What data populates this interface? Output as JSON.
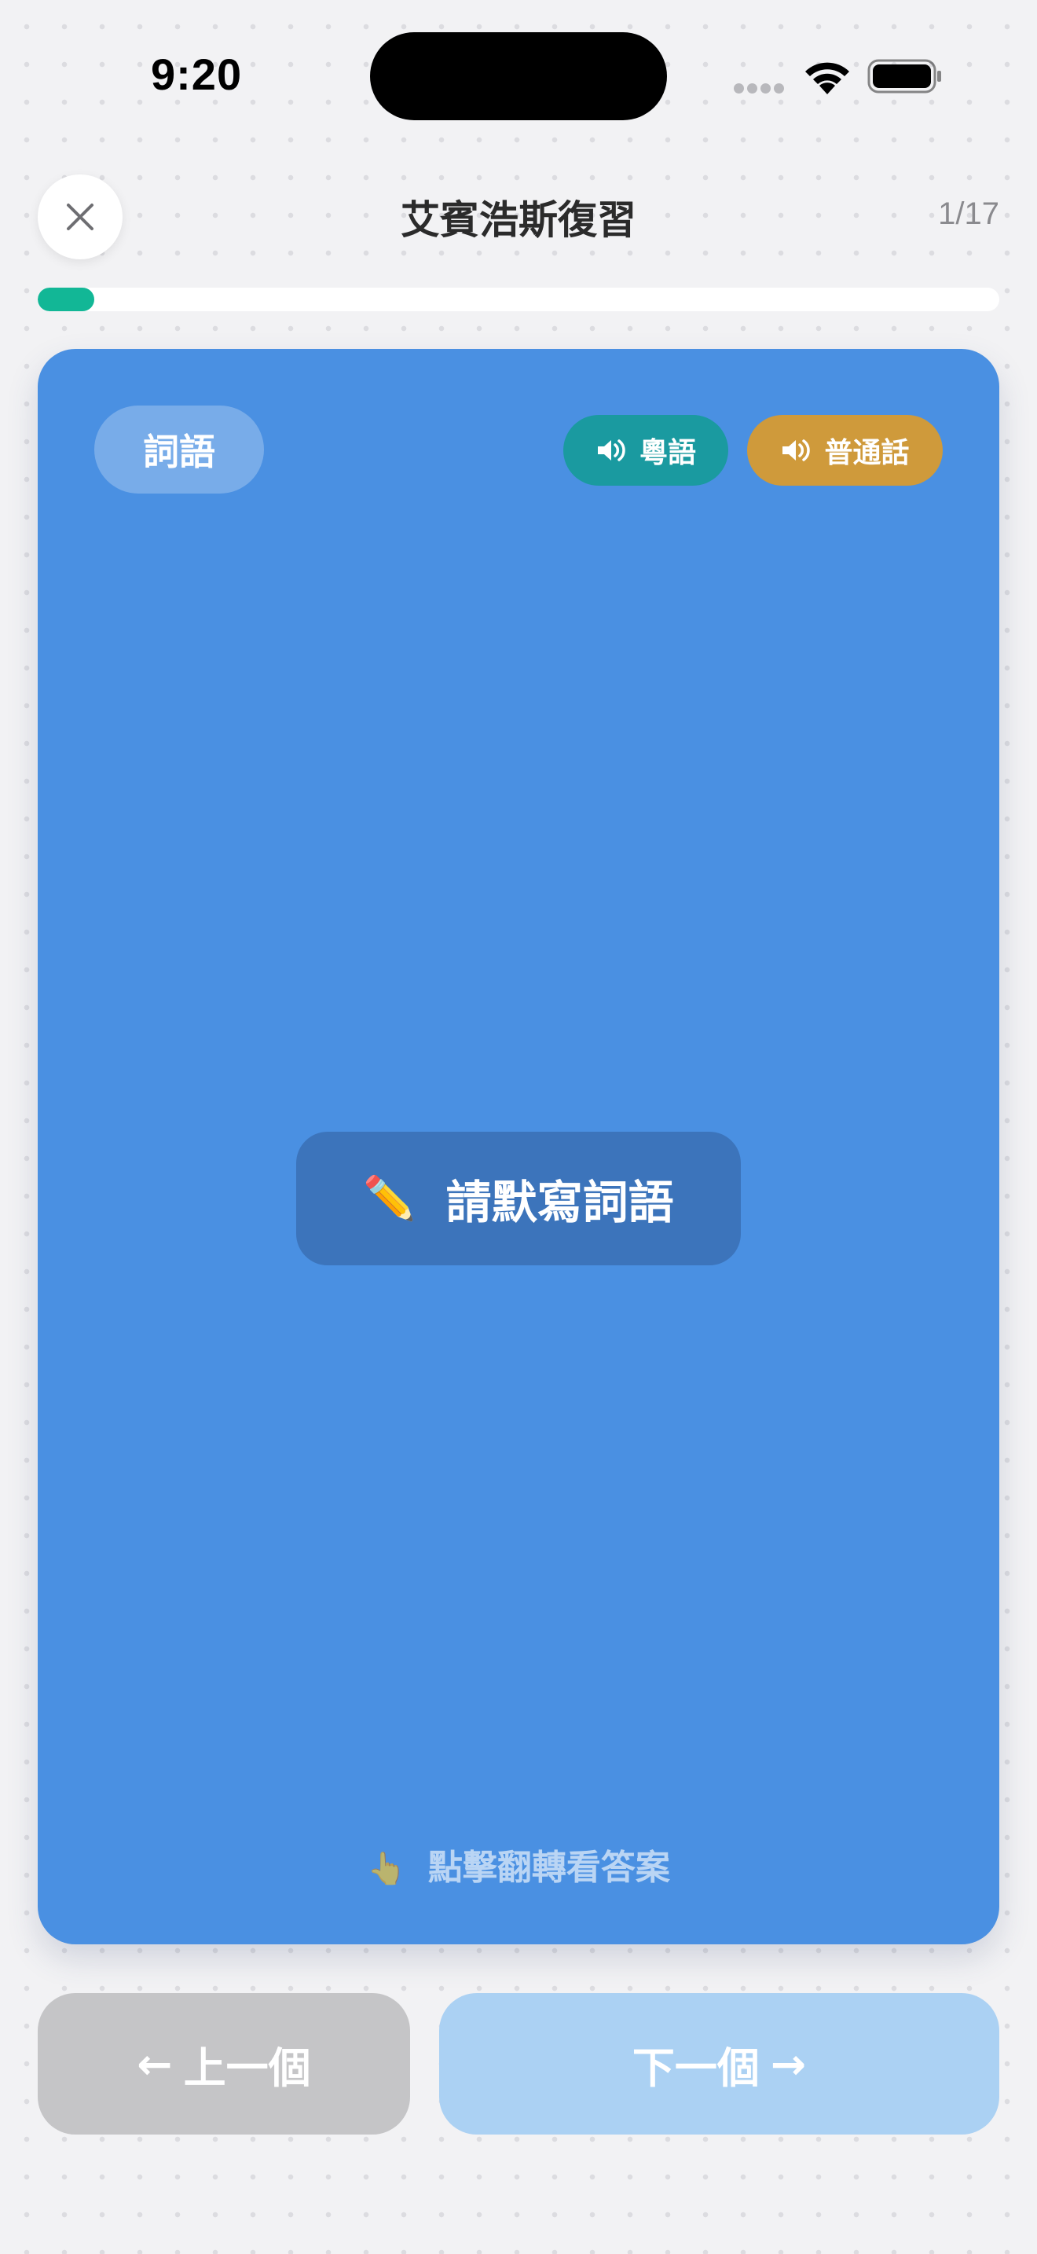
{
  "status_bar": {
    "time": "9:20"
  },
  "header": {
    "title": "艾賓浩斯復習",
    "progress_text": "1/17",
    "progress_fraction": 0.059,
    "close_icon": "close-icon"
  },
  "card": {
    "type_label": "詞語",
    "audio_cantonese_label": "粵語",
    "audio_mandarin_label": "普通話",
    "prompt_emoji": "✏️",
    "prompt_text": "請默寫詞語",
    "hint_emoji": "👆",
    "hint_text": "點擊翻轉看答案"
  },
  "navigation": {
    "prev_arrow": "←",
    "prev_label": "上一個",
    "next_label": "下一個",
    "next_arrow": "→"
  },
  "colors": {
    "card_background": "#4a90e2",
    "progress_fill": "#12b796",
    "cantonese_button": "#1a9aa0",
    "mandarin_button": "#cf9a3b",
    "prev_button": "#c5c5c7",
    "next_button": "#abd1f3"
  }
}
